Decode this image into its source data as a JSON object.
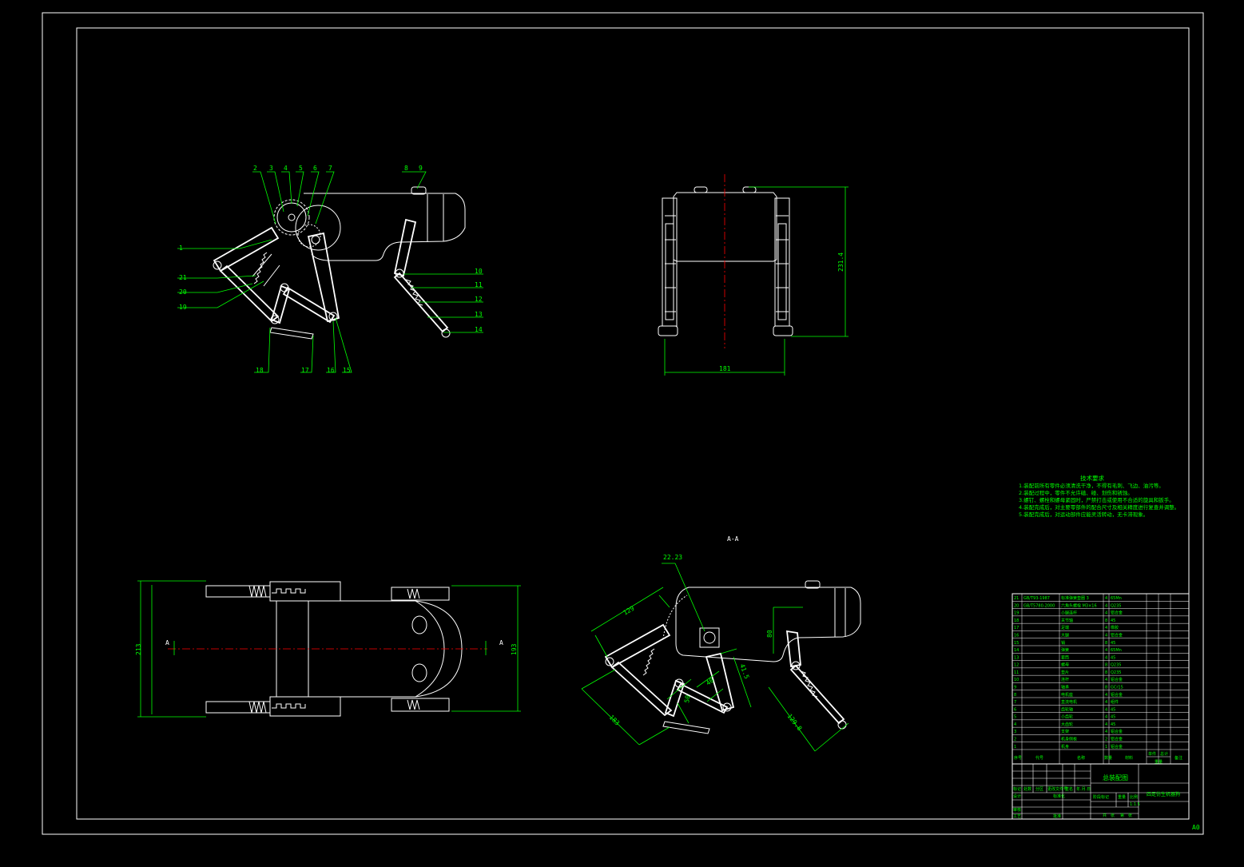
{
  "colors": {
    "background": "#000000",
    "outline": "#ffffff",
    "annotation": "#00ff00",
    "centerline": "#ff0000"
  },
  "sheet_size": "A0",
  "side_view": {
    "balloons_top": [
      "2",
      "3",
      "4",
      "5",
      "6",
      "7",
      "8",
      "9"
    ],
    "balloons_left": [
      "1",
      "21",
      "20",
      "19"
    ],
    "balloons_bottom": [
      "18",
      "17",
      "16",
      "15"
    ],
    "balloons_right": [
      "10",
      "11",
      "12",
      "13",
      "14"
    ]
  },
  "front_view": {
    "height_dim": "231.4",
    "width_dim": "181"
  },
  "top_view": {
    "width_dim": "213",
    "height_dim": "193",
    "section_left": "A",
    "section_right": "A"
  },
  "section_view": {
    "title": "A-A",
    "dims": [
      "22.23",
      "129",
      "183",
      "50",
      "40",
      "80",
      "41.5",
      "129.8"
    ]
  },
  "technical_requirements": {
    "title": "技术要求",
    "items": [
      "1.装配前所有零件必须清洗干净，不得有毛刺、飞边、油污等。",
      "2.装配过程中，零件不允许磕、碰、划伤和锈蚀。",
      "3.螺钉、螺栓和螺母紧固时，严禁打击或使用不合适的旋具和扳手。",
      "4.装配完成后，对主要零部件的配合尺寸及相关精度进行复查并调整。",
      "5.装配完成后，对运动部件应能灵活转动，无卡滞现象。"
    ]
  },
  "bom": {
    "rows": [
      {
        "no": "21",
        "code": "GB/T93-1987",
        "name": "标准弹簧垫圈 3",
        "qty": "4",
        "mat": "65Mn"
      },
      {
        "no": "20",
        "code": "GB/T5780-2000",
        "name": "六角头螺栓 M3×16",
        "qty": "4",
        "mat": "Q235"
      },
      {
        "no": "19",
        "code": "",
        "name": "小腿连杆",
        "qty": "4",
        "mat": "铝合金"
      },
      {
        "no": "18",
        "code": "",
        "name": "关节轴",
        "qty": "8",
        "mat": "45"
      },
      {
        "no": "17",
        "code": "",
        "name": "足端",
        "qty": "4",
        "mat": "橡胶"
      },
      {
        "no": "16",
        "code": "",
        "name": "大腿",
        "qty": "4",
        "mat": "铝合金"
      },
      {
        "no": "15",
        "code": "",
        "name": "销",
        "qty": "8",
        "mat": "45"
      },
      {
        "no": "14",
        "code": "",
        "name": "弹簧",
        "qty": "4",
        "mat": "65Mn"
      },
      {
        "no": "13",
        "code": "",
        "name": "套筒",
        "qty": "4",
        "mat": "45"
      },
      {
        "no": "12",
        "code": "",
        "name": "螺母",
        "qty": "8",
        "mat": "Q235"
      },
      {
        "no": "11",
        "code": "",
        "name": "垫片",
        "qty": "8",
        "mat": "Q235"
      },
      {
        "no": "10",
        "code": "",
        "name": "连杆",
        "qty": "4",
        "mat": "铝合金"
      },
      {
        "no": "9",
        "code": "",
        "name": "轴承",
        "qty": "8",
        "mat": "GCr15"
      },
      {
        "no": "8",
        "code": "",
        "name": "电机座",
        "qty": "4",
        "mat": "铝合金"
      },
      {
        "no": "7",
        "code": "",
        "name": "直流电机",
        "qty": "4",
        "mat": "组件"
      },
      {
        "no": "6",
        "code": "",
        "name": "齿轮轴",
        "qty": "4",
        "mat": "45"
      },
      {
        "no": "5",
        "code": "",
        "name": "小齿轮",
        "qty": "4",
        "mat": "45"
      },
      {
        "no": "4",
        "code": "",
        "name": "大齿轮",
        "qty": "4",
        "mat": "45"
      },
      {
        "no": "3",
        "code": "",
        "name": "支架",
        "qty": "4",
        "mat": "铝合金"
      },
      {
        "no": "2",
        "code": "",
        "name": "机身侧板",
        "qty": "2",
        "mat": "铝合金"
      },
      {
        "no": "1",
        "code": "",
        "name": "机身",
        "qty": "1",
        "mat": "铝合金"
      }
    ],
    "header": {
      "no": "序号",
      "code": "代号",
      "name": "名称",
      "qty": "数量",
      "mat": "材料",
      "single": "单件",
      "total": "总计",
      "weight": "重量",
      "remark": "备注"
    }
  },
  "title_block": {
    "drawing_name": "总装配图",
    "product_name": "四足仿生机器狗",
    "scale": "1:1.5",
    "cells": [
      "标记",
      "处数",
      "分区",
      "更改文件号",
      "签名",
      "年.月.日",
      "设计",
      "标准化",
      "阶段标记",
      "重量",
      "比例",
      "审核",
      "工艺",
      "批准",
      "共",
      "张",
      "第",
      "张"
    ]
  }
}
